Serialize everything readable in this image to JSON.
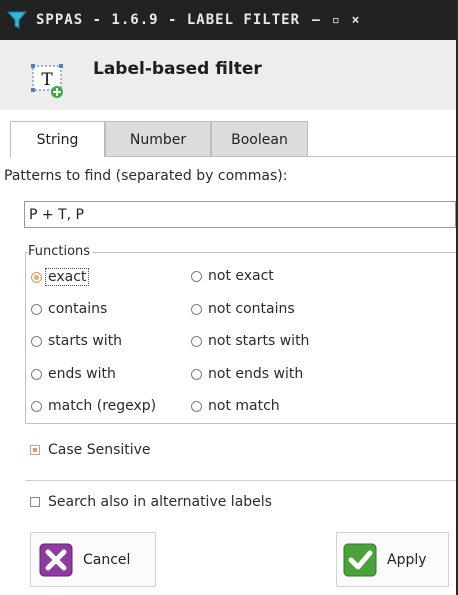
{
  "window": {
    "title": "SPPAS - 1.6.9 - LABEL FILTER",
    "minimize": "–",
    "maximize": "▫",
    "close": "×"
  },
  "header": {
    "title": "Label-based filter",
    "icon_glyph": "T"
  },
  "tabs": [
    {
      "label": "String",
      "active": true
    },
    {
      "label": "Number",
      "active": false
    },
    {
      "label": "Boolean",
      "active": false
    }
  ],
  "prompt": "Patterns to find (separated by commas):",
  "pattern_value": "P + T, P",
  "functions": {
    "legend": "Functions",
    "options": {
      "exact": "exact",
      "not_exact": "not exact",
      "contains": "contains",
      "not_contains": "not contains",
      "starts_with": "starts with",
      "not_starts_with": "not starts with",
      "ends_with": "ends with",
      "not_ends_with": "not ends with",
      "match": "match (regexp)",
      "not_match": "not match"
    },
    "selected": "exact"
  },
  "case_sensitive": {
    "label": "Case Sensitive",
    "checked": true
  },
  "alt_labels": {
    "label": "Search also in alternative labels",
    "checked": false
  },
  "buttons": {
    "cancel": "Cancel",
    "apply": "Apply"
  },
  "colors": {
    "titlebar": "#222222",
    "radio_accent": "#e9a778",
    "cancel_icon": "#8e3aa0",
    "apply_icon": "#4aa33a"
  },
  "icons": {
    "app": "filter-funnel-icon",
    "header": "text-add-icon",
    "cancel": "cross-icon",
    "apply": "checkmark-icon"
  }
}
